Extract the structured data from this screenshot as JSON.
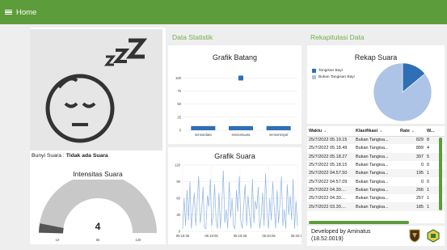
{
  "header": {
    "title": "Home"
  },
  "sound_status": {
    "label": "Bunyi Suara : ",
    "value": "Tidak ada Suara"
  },
  "gauge": {
    "title": "Intensitas Suara",
    "value": "4",
    "min": "10",
    "mid": "65",
    "max": "120"
  },
  "statistik": {
    "section_title": "Data Statistik",
    "bar_chart": {
      "title": "Grafik Batang",
      "y_ticks": [
        "100",
        "75",
        "50",
        "25",
        "0"
      ],
      "categories": [
        "sensordata",
        "sensorsuara",
        "sensorsinyal"
      ]
    },
    "line_chart": {
      "title": "Grafik Suara",
      "y_ticks": [
        "120",
        "90",
        "60",
        "30",
        "0"
      ],
      "x_ticks": [
        "05:18:35",
        "05:19:05",
        "05:19:35",
        "05:20:05",
        "05:20:36"
      ]
    }
  },
  "rekap": {
    "section_title": "Rekapitulasi Data",
    "pie_title": "Rekap Suara",
    "legend": [
      {
        "label": "Tangisan Bayi",
        "color": "#2e6fb5"
      },
      {
        "label": "Bukan Tangisan Bayi",
        "color": "#aec4e6"
      }
    ],
    "table": {
      "columns": [
        "Waktu",
        "Klasifikasi",
        "Rate",
        "W..."
      ],
      "rows": [
        [
          "25/7/2022 05.19.15",
          "Bukan Tangisa...",
          "829",
          "8"
        ],
        [
          "25/7/2022 05.18.49",
          "Bukan Tangisa...",
          "899",
          "4"
        ],
        [
          "25/7/2022 05.18.27",
          "Bukan Tangisa...",
          "397",
          "5"
        ],
        [
          "25/7/2022 05.18.15",
          "Bukan Tangisa...",
          "0",
          "0"
        ],
        [
          "25/7/2022 04.57.50",
          "Bukan Tangisa...",
          "195",
          "1"
        ],
        [
          "25/7/2022 04.57.09",
          "Bukan Tangisa...",
          "0",
          "0"
        ],
        [
          "25/7/2022 04.30....",
          "Bukan Tangisa...",
          "266",
          "1"
        ],
        [
          "25/7/2022 04.30....",
          "Bukan Tangisa...",
          "257",
          "1"
        ],
        [
          "25/7/2022 03.30....",
          "Bukan Tangisa...",
          "185",
          "1"
        ]
      ]
    }
  },
  "footer": {
    "developer": "Developed by Aminatus",
    "nim": "(18.52.0019)"
  },
  "chart_data": [
    {
      "type": "bar",
      "title": "Grafik Batang",
      "categories": [
        "sensordata",
        "sensorsuara",
        "sensorsinyal"
      ],
      "values": [
        8,
        8,
        8
      ],
      "outlier": {
        "category": "sensorsuara",
        "value": 100
      },
      "ylim": [
        0,
        110
      ]
    },
    {
      "type": "line",
      "title": "Grafik Suara",
      "x": [
        "05:18:35",
        "05:19:05",
        "05:19:35",
        "05:20:05",
        "05:20:36"
      ],
      "ylim": [
        0,
        120
      ],
      "values": [
        5,
        60,
        10,
        75,
        20,
        90,
        5,
        40,
        70,
        10,
        55,
        100,
        15,
        35,
        80,
        6,
        5,
        65,
        45,
        95,
        10,
        30,
        85,
        20,
        5,
        70,
        5,
        50,
        110,
        15,
        40,
        5,
        90,
        25,
        60,
        10,
        5,
        75,
        35,
        100,
        20,
        5,
        45,
        85,
        10,
        65,
        30,
        5,
        95,
        15,
        55,
        40,
        80,
        5,
        25,
        70,
        10,
        105,
        35,
        5,
        60,
        20,
        90,
        45,
        5,
        75,
        15,
        50,
        100,
        10,
        40,
        5,
        85,
        30,
        65,
        20,
        95,
        5,
        55,
        10
      ]
    },
    {
      "type": "pie",
      "title": "Rekap Suara",
      "labels": [
        "Tangisan Bayi",
        "Bukan Tangisan Bayi"
      ],
      "values": [
        14,
        86
      ]
    }
  ],
  "colors": {
    "accent": "#5d9c3a",
    "bar": "#2e6fb5",
    "line": "#8fb4e3"
  },
  "icons": {
    "sleep": "sleeping-baby-face",
    "logo1": "shield-logo",
    "logo2": "emblem-logo"
  }
}
